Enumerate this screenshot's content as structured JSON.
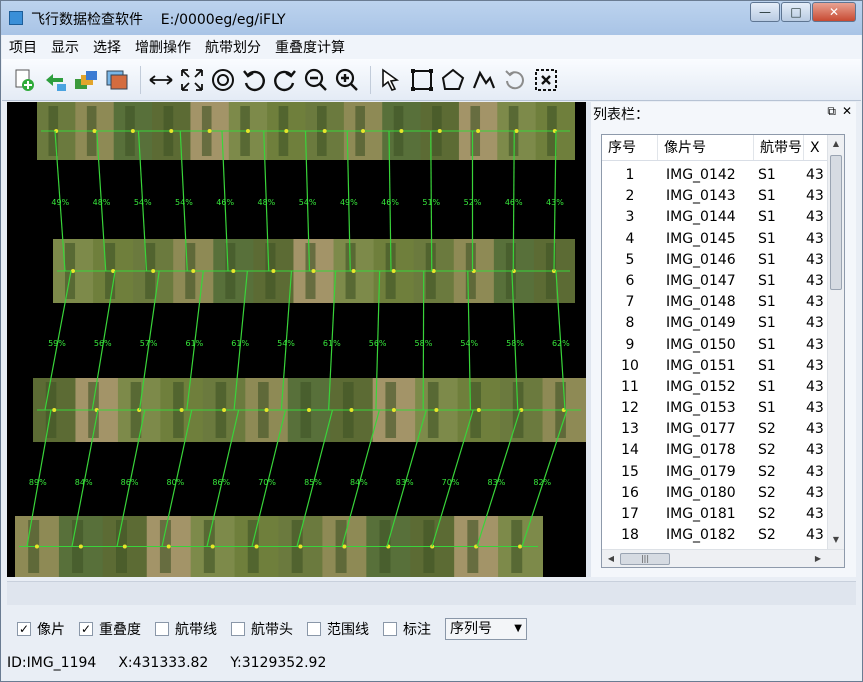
{
  "window": {
    "title": "飞行数据检查软件    E:/0000eg/eg/iFLY",
    "min_glyph": "—",
    "max_glyph": "□",
    "close_glyph": "✕"
  },
  "menu": [
    "项目",
    "显示",
    "选择",
    "增删操作",
    "航带划分",
    "重叠度计算"
  ],
  "toolbar": {
    "icons": [
      "add-project-icon",
      "import-icon",
      "layers-icon",
      "image-stack-icon",
      "pan-horizontal-icon",
      "full-extent-icon",
      "refresh-view-icon",
      "rotate-left-icon",
      "rotate-right-icon",
      "zoom-out-icon",
      "zoom-in-icon",
      "select-arrow-icon",
      "rectangle-select-icon",
      "polygon-select-icon",
      "polyline-select-icon",
      "undo-icon",
      "delete-selection-icon"
    ]
  },
  "panel": {
    "title": "列表栏：",
    "pin_glyph": "⧉",
    "close_glyph": "✕"
  },
  "table": {
    "headers": [
      "序号",
      "像片号",
      "航带号",
      "X"
    ],
    "rows": [
      [
        "1",
        "IMG_0142",
        "S1",
        "43"
      ],
      [
        "2",
        "IMG_0143",
        "S1",
        "43"
      ],
      [
        "3",
        "IMG_0144",
        "S1",
        "43"
      ],
      [
        "4",
        "IMG_0145",
        "S1",
        "43"
      ],
      [
        "5",
        "IMG_0146",
        "S1",
        "43"
      ],
      [
        "6",
        "IMG_0147",
        "S1",
        "43"
      ],
      [
        "7",
        "IMG_0148",
        "S1",
        "43"
      ],
      [
        "8",
        "IMG_0149",
        "S1",
        "43"
      ],
      [
        "9",
        "IMG_0150",
        "S1",
        "43"
      ],
      [
        "10",
        "IMG_0151",
        "S1",
        "43"
      ],
      [
        "11",
        "IMG_0152",
        "S1",
        "43"
      ],
      [
        "12",
        "IMG_0153",
        "S1",
        "43"
      ],
      [
        "13",
        "IMG_0177",
        "S2",
        "43"
      ],
      [
        "14",
        "IMG_0178",
        "S2",
        "43"
      ],
      [
        "15",
        "IMG_0179",
        "S2",
        "43"
      ],
      [
        "16",
        "IMG_0180",
        "S2",
        "43"
      ],
      [
        "17",
        "IMG_0181",
        "S2",
        "43"
      ],
      [
        "18",
        "IMG_0182",
        "S2",
        "43"
      ]
    ]
  },
  "map": {
    "strip_gaps": [
      [
        "49%",
        "48%",
        "54%",
        "54%",
        "46%",
        "48%",
        "54%",
        "49%",
        "46%",
        "51%",
        "52%",
        "46%",
        "43%"
      ],
      [
        "59%",
        "56%",
        "57%",
        "61%",
        "61%",
        "54%",
        "61%",
        "56%",
        "58%",
        "54%",
        "58%",
        "62%"
      ],
      [
        "89%",
        "84%",
        "86%",
        "80%",
        "86%",
        "70%",
        "85%",
        "84%",
        "83%",
        "70%",
        "83%",
        "82%"
      ]
    ],
    "colors": {
      "link": "#39d43a",
      "label": "#37e63b",
      "background": "#000000"
    }
  },
  "options": {
    "checkboxes": [
      {
        "label": "像片",
        "checked": true
      },
      {
        "label": "重叠度",
        "checked": true
      },
      {
        "label": "航带线",
        "checked": false
      },
      {
        "label": "航带头",
        "checked": false
      },
      {
        "label": "范围线",
        "checked": false
      },
      {
        "label": "标注",
        "checked": false
      }
    ],
    "check_glyph": "✓",
    "select_value": "序列号"
  },
  "status": {
    "id": "ID:IMG_1194",
    "x": "X:431333.82",
    "y": "Y:3129352.92"
  }
}
